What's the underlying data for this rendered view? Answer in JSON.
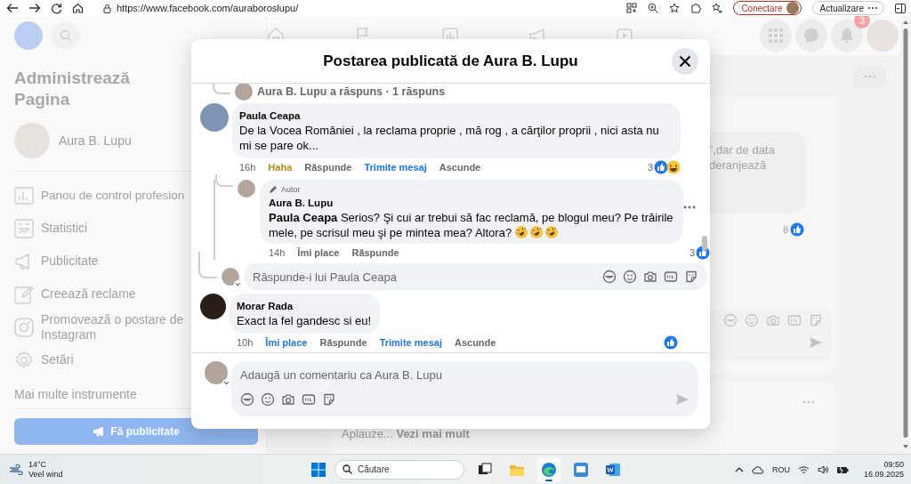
{
  "browser": {
    "url": "https://www.facebook.com/auraboroslupu/",
    "sign_in_button": "Conectare",
    "update_button": "Actualizare"
  },
  "nav": {
    "notifications_badge": "3"
  },
  "sidebar": {
    "title": "Administrează Pagina",
    "page_name": "Aura B. Lupu",
    "more_tools": "Mai multe instrumente",
    "cta_button": "Fă publicitate",
    "items": [
      {
        "label": "Panou de control profesion"
      },
      {
        "label": "Statistici"
      },
      {
        "label": "Publicitate"
      },
      {
        "label": "Creează reclame"
      },
      {
        "label": "Promovează o postare de Instagram"
      },
      {
        "label": "Setări"
      }
    ]
  },
  "feed": {
    "snippet_lines": [
      "”,dar de data",
      "deranjează"
    ],
    "like_count": "8",
    "footer_text": "Aplauze...",
    "footer_link": "Vezi mai mult"
  },
  "modal": {
    "title": "Postarea publicată de Aura B. Lupu",
    "replies_summary": "Aura B. Lupu a răspuns · 1 răspuns",
    "comments": [
      {
        "author": "Paula Ceapa",
        "text": "De la Vocea României , la reclama proprie , mă rog , a cărţilor proprii , nici asta nu mi se pare ok...",
        "time": "16h",
        "actions": [
          {
            "label": "Haha",
            "kind": "haha"
          },
          {
            "label": "Răspunde",
            "kind": "plain"
          },
          {
            "label": "Trimite mesaj",
            "kind": "link"
          },
          {
            "label": "Ascunde",
            "kind": "plain"
          }
        ],
        "reaction_count": "3",
        "reactions": [
          {
            "kind": "like"
          },
          {
            "kind": "haha"
          }
        ],
        "replies": [
          {
            "author": "Aura B. Lupu",
            "badge": "Autor",
            "text": "**Paula Ceapa** Serios? Şi cui ar trebui să fac reclamă, pe blogul meu? Pe trăirile mele, pe scrisul meu şi pe mintea mea? Altora?",
            "emojis": [
              {
                "kind": "rofl"
              },
              {
                "kind": "rofl"
              },
              {
                "kind": "rofl"
              }
            ],
            "time": "14h",
            "actions": [
              {
                "label": "Îmi place",
                "kind": "plain"
              },
              {
                "label": "Răspunde",
                "kind": "plain"
              }
            ],
            "reaction_count": "3",
            "reactions": [
              {
                "kind": "like"
              }
            ]
          }
        ],
        "reply_box": {
          "placeholder": "Răspunde-i lui Paula Ceapa"
        }
      },
      {
        "author": "Morar Rada",
        "text": "Exact la fel gandesc si eu!",
        "time": "10h",
        "actions": [
          {
            "label": "Îmi place",
            "kind": "liked"
          },
          {
            "label": "Răspunde",
            "kind": "plain"
          },
          {
            "label": "Trimite mesaj",
            "kind": "link"
          },
          {
            "label": "Ascunde",
            "kind": "plain"
          }
        ],
        "reactions": [
          {
            "kind": "like"
          }
        ]
      }
    ],
    "comment_box": {
      "placeholder": "Adaugă un comentariu ca Aura B. Lupu"
    }
  },
  "taskbar": {
    "temperature": "14°C",
    "weather": "Veel wind",
    "search_placeholder": "Căutare",
    "apps": [
      {
        "selected": false
      },
      {
        "selected": false
      },
      {
        "selected": true
      },
      {
        "selected": false
      },
      {
        "selected": false
      }
    ],
    "language": "ROU",
    "time": "09:50",
    "date": "16.09.2025"
  }
}
